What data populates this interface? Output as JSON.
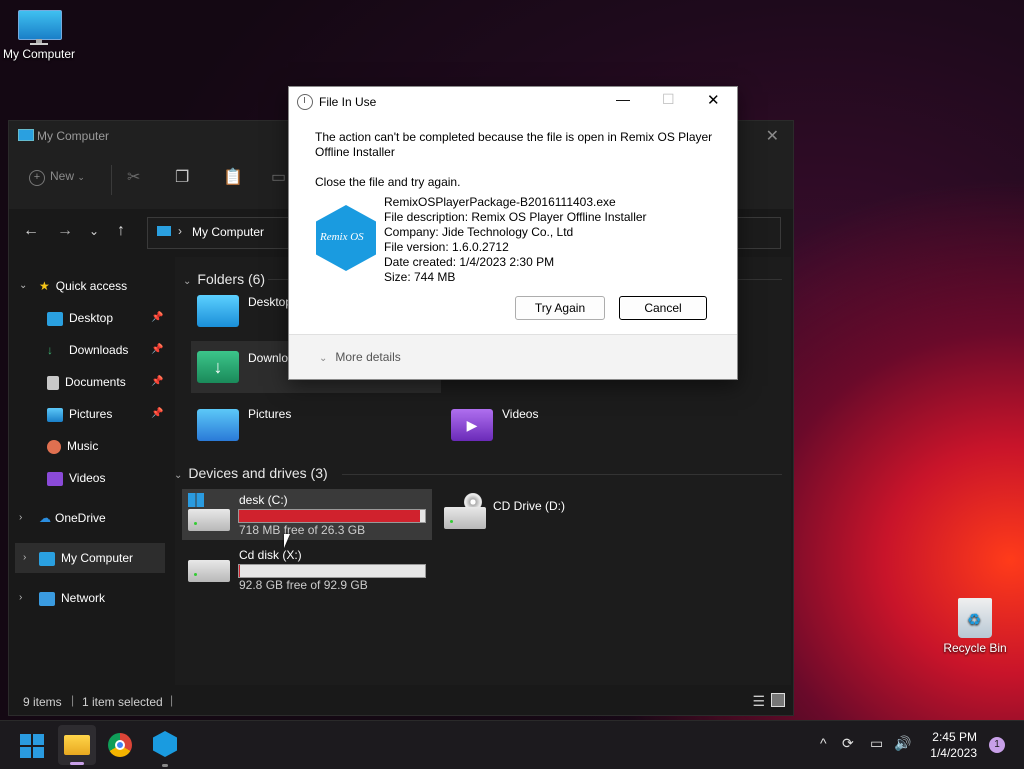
{
  "desktop": {
    "icons": [
      {
        "label": "My Computer"
      },
      {
        "label": "Recycle Bin"
      }
    ]
  },
  "explorer": {
    "title": "My Computer",
    "toolbar": {
      "new_label": "New"
    },
    "address": {
      "crumb": "My Computer"
    },
    "sidebar": {
      "quick_access": "Quick access",
      "items": [
        {
          "label": "Desktop"
        },
        {
          "label": "Downloads"
        },
        {
          "label": "Documents"
        },
        {
          "label": "Pictures"
        },
        {
          "label": "Music"
        },
        {
          "label": "Videos"
        }
      ],
      "onedrive": "OneDrive",
      "my_computer": "My Computer",
      "network": "Network"
    },
    "folders_header": "Folders (6)",
    "folders": [
      {
        "label": "Desktop"
      },
      {
        "label": "Downloads"
      },
      {
        "label": "Pictures"
      },
      {
        "label": "Videos"
      }
    ],
    "drives_header": "Devices and drives (3)",
    "drives": [
      {
        "label": "desk (C:)",
        "free_text": "718 MB free of 26.3 GB",
        "used_fraction": 0.973
      },
      {
        "label": "CD Drive (D:)"
      },
      {
        "label": "Cd disk (X:)",
        "free_text": "92.8 GB free of 92.9 GB",
        "used_fraction": 0.001
      }
    ],
    "status": {
      "items": "9 items",
      "selected": "1 item selected"
    }
  },
  "dialog": {
    "title": "File In Use",
    "message_line1": "The action can't be completed because the file is open in Remix OS Player",
    "message_line2": "Offline Installer",
    "instruction": "Close the file and try again.",
    "file_name": "RemixOSPlayerPackage-B2016111403.exe",
    "file_description": "File description: Remix OS Player Offline Installer",
    "company": "Company: Jide Technology Co., Ltd",
    "file_version": "File version: 1.6.0.2712",
    "date_created": "Date created: 1/4/2023 2:30 PM",
    "size": "Size: 744 MB",
    "logo_text": "Remix OS",
    "try_again": "Try Again",
    "cancel": "Cancel",
    "more_details": "More details"
  },
  "taskbar": {
    "time": "2:45 PM",
    "date": "1/4/2023",
    "notification_count": "1"
  },
  "colors": {
    "drive_full": "#d0222d",
    "accent_blue": "#1a9be0"
  }
}
